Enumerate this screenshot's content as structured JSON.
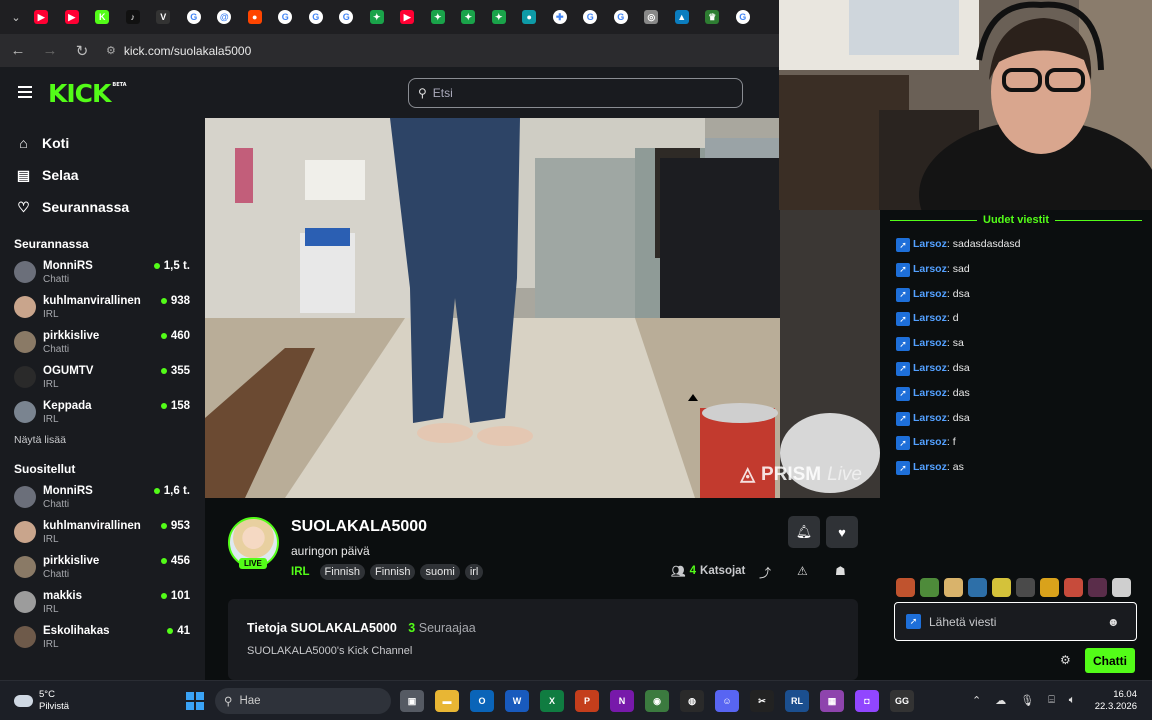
{
  "browser": {
    "tab_favicons": [
      {
        "icon": "youtube-icon",
        "color": "#ff0033",
        "glyph": "▶"
      },
      {
        "icon": "youtube-icon",
        "color": "#ff0033",
        "glyph": "▶"
      },
      {
        "icon": "kick-icon",
        "color": "#53fc18",
        "glyph": "K"
      },
      {
        "icon": "tiktok-icon",
        "color": "#111111",
        "glyph": "♪"
      },
      {
        "icon": "v-icon",
        "color": "#333333",
        "glyph": "V"
      },
      {
        "icon": "google-icon",
        "color": "#ffffff",
        "glyph": "G"
      },
      {
        "icon": "threads-icon",
        "color": "#ffffff",
        "glyph": "@"
      },
      {
        "icon": "reddit-icon",
        "color": "#ff4500",
        "glyph": "●"
      },
      {
        "icon": "google-icon",
        "color": "#ffffff",
        "glyph": "G"
      },
      {
        "icon": "google-icon",
        "color": "#ffffff",
        "glyph": "G"
      },
      {
        "icon": "google-icon",
        "color": "#ffffff",
        "glyph": "G"
      },
      {
        "icon": "leaf-icon",
        "color": "#1aa34a",
        "glyph": "✦"
      },
      {
        "icon": "youtube-icon",
        "color": "#ff0033",
        "glyph": "▶"
      },
      {
        "icon": "leaf-icon",
        "color": "#1aa34a",
        "glyph": "✦"
      },
      {
        "icon": "leaf-icon",
        "color": "#1aa34a",
        "glyph": "✦"
      },
      {
        "icon": "leaf-icon",
        "color": "#1aa34a",
        "glyph": "✦"
      },
      {
        "icon": "teal-icon",
        "color": "#0e9aa7",
        "glyph": "●"
      },
      {
        "icon": "grid-icon",
        "color": "#ffffff",
        "glyph": "✚"
      },
      {
        "icon": "google-icon",
        "color": "#ffffff",
        "glyph": "G"
      },
      {
        "icon": "google-icon",
        "color": "#ffffff",
        "glyph": "G"
      },
      {
        "icon": "globe-icon",
        "color": "#888888",
        "glyph": "◎"
      },
      {
        "icon": "chart-icon",
        "color": "#0b7dbf",
        "glyph": "▲"
      },
      {
        "icon": "crown-icon",
        "color": "#2e7d32",
        "glyph": "♛"
      },
      {
        "icon": "google-icon",
        "color": "#ffffff",
        "glyph": "G"
      }
    ],
    "url": "kick.com/suolakala5000"
  },
  "header": {
    "logo": "KICK",
    "logo_badge": "BETA",
    "search_placeholder": "Etsi"
  },
  "sidebar": {
    "nav": [
      {
        "label": "Koti",
        "icon": "home-icon",
        "glyph": "⌂"
      },
      {
        "label": "Selaa",
        "icon": "browse-icon",
        "glyph": "▤"
      },
      {
        "label": "Seurannassa",
        "icon": "heart-icon",
        "glyph": "♡"
      }
    ],
    "following_title": "Seurannassa",
    "following": [
      {
        "name": "MonniRS",
        "category": "Chatti",
        "viewers": "1,5 t.",
        "avatar": "#6b6f7a"
      },
      {
        "name": "kuhlmanvirallinen",
        "category": "IRL",
        "viewers": "938",
        "avatar": "#c9a58c"
      },
      {
        "name": "pirkkislive",
        "category": "Chatti",
        "viewers": "460",
        "avatar": "#8a7a66"
      },
      {
        "name": "OGUMTV",
        "category": "IRL",
        "viewers": "355",
        "avatar": "#2a2a2a"
      },
      {
        "name": "Keppada",
        "category": "IRL",
        "viewers": "158",
        "avatar": "#7a8490"
      }
    ],
    "show_more": "Näytä lisää",
    "recommended_title": "Suositellut",
    "recommended": [
      {
        "name": "MonniRS",
        "category": "Chatti",
        "viewers": "1,6 t.",
        "avatar": "#6b6f7a"
      },
      {
        "name": "kuhlmanvirallinen",
        "category": "IRL",
        "viewers": "953",
        "avatar": "#c9a58c"
      },
      {
        "name": "pirkkislive",
        "category": "Chatti",
        "viewers": "456",
        "avatar": "#8a7a66"
      },
      {
        "name": "makkis",
        "category": "IRL",
        "viewers": "101",
        "avatar": "#9c9c9c"
      },
      {
        "name": "Eskolihakas",
        "category": "IRL",
        "viewers": "41",
        "avatar": "#6e5a4a"
      }
    ]
  },
  "video": {
    "watermark": "PRISM",
    "watermark_suffix": "Live"
  },
  "stream": {
    "channel": "SUOLAKALA5000",
    "live_badge": "LIVE",
    "title": "auringon päivä",
    "category": "IRL",
    "tags": [
      "Finnish",
      "Finnish",
      "suomi",
      "irl"
    ],
    "viewers_count": "4",
    "viewers_label": "Katsojat",
    "about_title": "Tietoja SUOLAKALA5000",
    "followers_count": "3",
    "followers_label": "Seuraajaa",
    "description": "SUOLAKALA5000's Kick Channel"
  },
  "chat": {
    "header": "Uudet viestit",
    "messages": [
      {
        "user": "Larsoz",
        "text": "sadasdasdasd"
      },
      {
        "user": "Larsoz",
        "text": "sad"
      },
      {
        "user": "Larsoz",
        "text": "dsa"
      },
      {
        "user": "Larsoz",
        "text": "d"
      },
      {
        "user": "Larsoz",
        "text": "sa"
      },
      {
        "user": "Larsoz",
        "text": "dsa"
      },
      {
        "user": "Larsoz",
        "text": "das"
      },
      {
        "user": "Larsoz",
        "text": "dsa"
      },
      {
        "user": "Larsoz",
        "text": "f"
      },
      {
        "user": "Larsoz",
        "text": "as"
      }
    ],
    "emote_colors": [
      "#c0532e",
      "#4e8b3a",
      "#d9b36b",
      "#2d6fa8",
      "#d4c23a",
      "#4a4a4a",
      "#d9a21b",
      "#c74b3b",
      "#5a2d4a",
      "#cfcfcf"
    ],
    "input_placeholder": "Lähetä viesti",
    "send_label": "Chatti"
  },
  "taskbar": {
    "temp": "5°C",
    "weather": "Pilvistä",
    "search": "Hae",
    "apps": [
      {
        "icon": "task-view-icon",
        "color": "#555a63",
        "glyph": "▣"
      },
      {
        "icon": "file-explorer-icon",
        "color": "#e8b634",
        "glyph": "▬"
      },
      {
        "icon": "outlook-icon",
        "color": "#0a64b8",
        "glyph": "O"
      },
      {
        "icon": "word-icon",
        "color": "#185abd",
        "glyph": "W"
      },
      {
        "icon": "excel-icon",
        "color": "#107c41",
        "glyph": "X"
      },
      {
        "icon": "powerpoint-icon",
        "color": "#c43e1c",
        "glyph": "P"
      },
      {
        "icon": "onenote-icon",
        "color": "#7719aa",
        "glyph": "N"
      },
      {
        "icon": "chrome-icon",
        "color": "#3b7a3f",
        "glyph": "◉"
      },
      {
        "icon": "obs-icon",
        "color": "#2a2a2a",
        "glyph": "◍"
      },
      {
        "icon": "discord-icon",
        "color": "#5865f2",
        "glyph": "☺"
      },
      {
        "icon": "capcut-icon",
        "color": "#222222",
        "glyph": "✂"
      },
      {
        "icon": "rl-icon",
        "color": "#1b4f8f",
        "glyph": "RL"
      },
      {
        "icon": "clapper-icon",
        "color": "#8e44ad",
        "glyph": "▦"
      },
      {
        "icon": "twitch-icon",
        "color": "#9146ff",
        "glyph": "◘"
      },
      {
        "icon": "gg-icon",
        "color": "#333333",
        "glyph": "GG"
      }
    ],
    "time": "16.04",
    "date": "22.3.2026"
  }
}
